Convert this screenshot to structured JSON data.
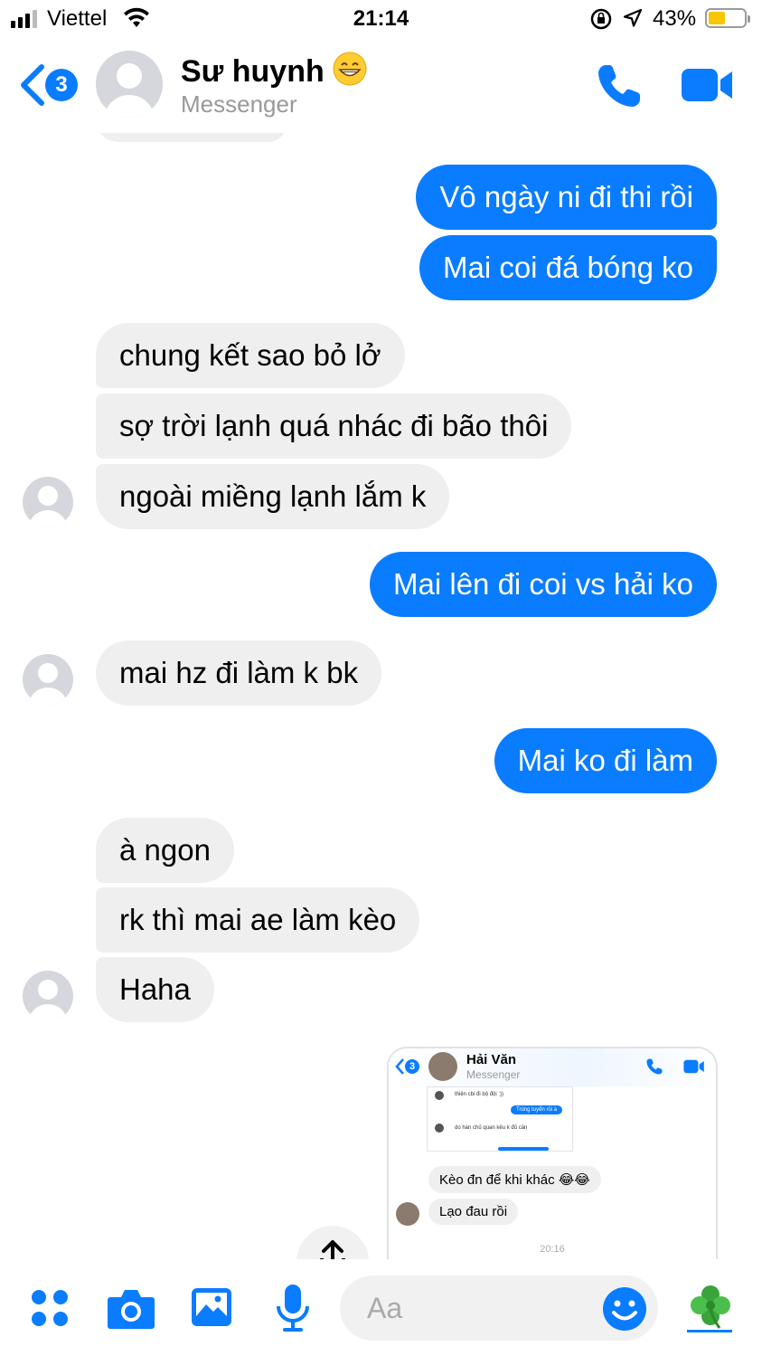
{
  "status_bar": {
    "carrier": "Viettel",
    "time": "21:14",
    "battery_percent": "43%",
    "battery_level": 0.43,
    "icons": [
      "signal-icon",
      "wifi-icon",
      "rotation-lock-icon",
      "location-arrow-icon",
      "battery-icon"
    ]
  },
  "header": {
    "back_badge": "3",
    "contact_name": "Sư huynh",
    "contact_emoji": "grinning-face-icon",
    "subtitle": "Messenger",
    "icons": [
      "back-chevron-icon",
      "phone-icon",
      "video-camera-icon"
    ]
  },
  "messages": [
    {
      "dir": "out",
      "text": "Vô ngày ni đi thi rồi"
    },
    {
      "dir": "out",
      "text": "Mai coi đá bóng ko"
    },
    {
      "dir": "in",
      "text": "chung kết sao bỏ lở"
    },
    {
      "dir": "in",
      "text": "sợ trời lạnh quá nhác đi bão thôi"
    },
    {
      "dir": "in",
      "text": "ngoài miềng lạnh lắm k"
    },
    {
      "dir": "out",
      "text": "Mai lên đi coi vs hải ko"
    },
    {
      "dir": "in",
      "text": "mai hz đi làm k bk"
    },
    {
      "dir": "out",
      "text": "Mai ko đi làm"
    },
    {
      "dir": "in",
      "text": "à ngon"
    },
    {
      "dir": "in",
      "text": "rk thì mai ae làm kèo"
    },
    {
      "dir": "in",
      "text": "Haha"
    }
  ],
  "shared_screenshot": {
    "badge": "3",
    "name": "Hải Văn",
    "subtitle": "Messenger",
    "tiny_1": "thiện cbi đi bộ đội :))",
    "tiny_2": "Trúng tuyển rồi à",
    "tiny_3": "do hàn chủ quan kêu k đủ cân",
    "bubble_1": "Kèo đn để khi khác 😂😂",
    "bubble_2": "Lạo đau rồi",
    "time": "20:16"
  },
  "composer": {
    "placeholder": "Aa",
    "icons": [
      "apps-icon",
      "camera-icon",
      "gallery-icon",
      "microphone-icon",
      "emoji-smile-icon",
      "clover-icon"
    ]
  },
  "colors": {
    "accent": "#0a7cff",
    "incoming_bubble": "#efefef",
    "battery": "#f7c600"
  }
}
